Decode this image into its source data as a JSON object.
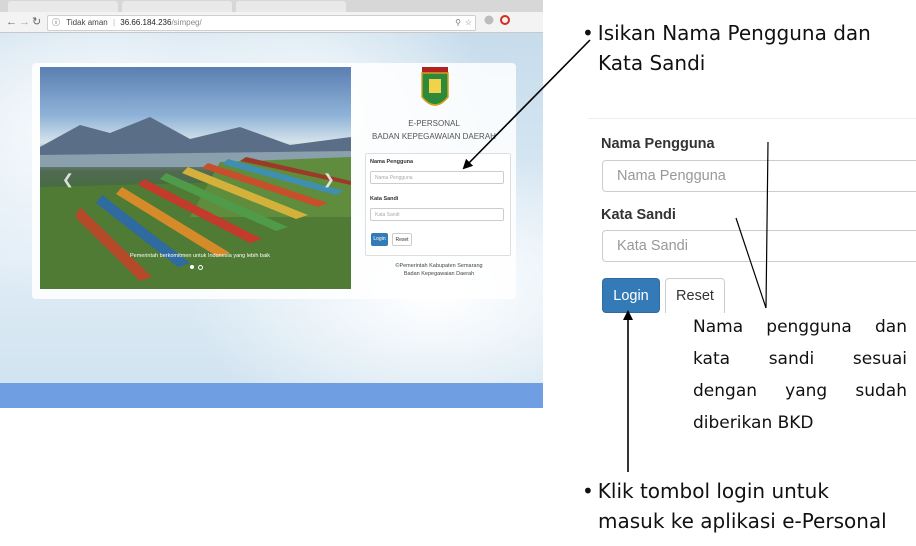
{
  "browser": {
    "security_label": "Tidak aman",
    "url_host": "36.66.184.236",
    "url_path": "/simpeg/",
    "nav_back_icon": "arrow-left-icon",
    "nav_forward_icon": "arrow-right-icon",
    "reload_icon": "reload-icon"
  },
  "page": {
    "app_title": "E-PERSONAL",
    "org_title": "BADAN KEPEGAWAIAN DAERAH",
    "carousel_caption": "Pemerintah berkomitmen untuk Indonesia yang lebih baik",
    "form": {
      "username_label": "Nama Pengguna",
      "username_placeholder": "Nama Pengguna",
      "password_label": "Kata Sandi",
      "password_placeholder": "Kata Sandi",
      "login_label": "Login",
      "reset_label": "Reset"
    },
    "footer_line1": "©Pemerintah Kabupaten Semarang",
    "footer_line2": "Badan Kepegawaian Daerah",
    "colors": {
      "primary_button": "#337ab7",
      "footer_bar": "#6f9ee3"
    }
  },
  "annotations": {
    "instruction1_line1": "Isikan Nama Pengguna dan",
    "instruction1_line2": "Kata Sandi",
    "zoom_form": {
      "username_label": "Nama Pengguna",
      "username_placeholder": "Nama Pengguna",
      "password_label": "Kata Sandi",
      "password_placeholder": "Kata Sandi",
      "login_label": "Login",
      "reset_label": "Reset"
    },
    "note_lines": [
      "Nama pengguna dan",
      "kata sandi sesuai",
      "dengan yang sudah",
      "diberikan BKD"
    ],
    "instruction2_line1": "Klik tombol login untuk",
    "instruction2_line2": "masuk ke aplikasi e-Personal"
  }
}
